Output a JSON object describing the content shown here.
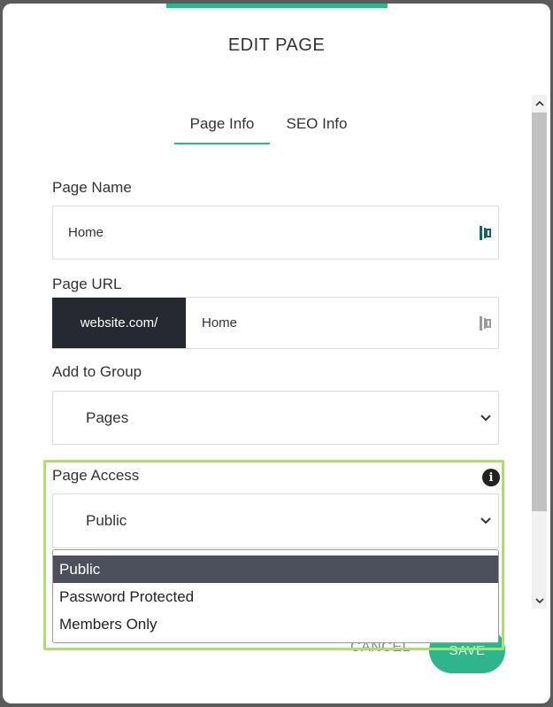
{
  "dialog": {
    "title": "EDIT PAGE"
  },
  "tabs": [
    {
      "label": "Page Info",
      "active": true
    },
    {
      "label": "SEO Info",
      "active": false
    }
  ],
  "form": {
    "page_name": {
      "label": "Page Name",
      "value": "Home"
    },
    "page_url": {
      "label": "Page URL",
      "prefix": "website.com/",
      "value": "Home"
    },
    "group": {
      "label": "Add to Group",
      "selected": "Pages"
    },
    "access": {
      "label": "Page Access",
      "selected": "Public",
      "options": [
        "Public",
        "Password Protected",
        "Members Only"
      ]
    }
  },
  "actions": {
    "cancel_label": "CANCEL",
    "save_label": "SAVE"
  },
  "colors": {
    "accent": "#2fb58b",
    "highlight": "#a8e84a",
    "dropdown_selected": "#4d4f5c",
    "url_prefix_bg": "#262a30"
  }
}
